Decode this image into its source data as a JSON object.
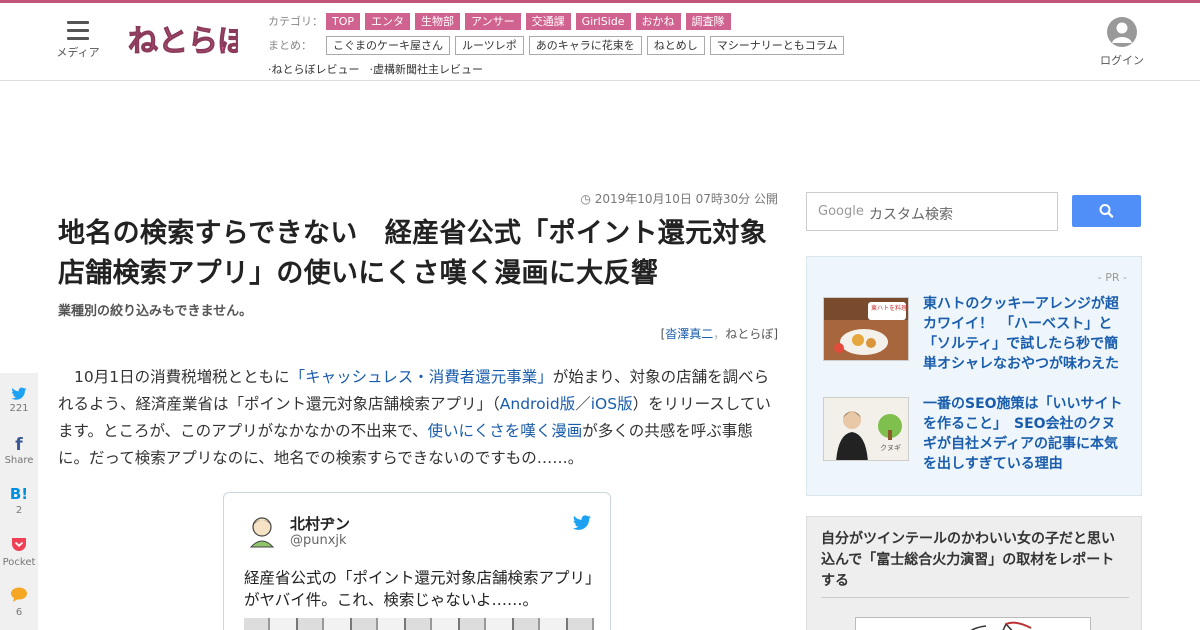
{
  "header": {
    "menu_label": "メディア",
    "logo_text": "ねとらぼ",
    "login_label": "ログイン",
    "category_label": "カテゴリ：",
    "categories": [
      "TOP",
      "エンタ",
      "生物部",
      "アンサー",
      "交通課",
      "GirlSide",
      "おかね",
      "調査隊"
    ],
    "matome_label": "まとめ：",
    "matome": [
      "こぐまのケーキ屋さん",
      "ルーツレポ",
      "あのキャラに花束を",
      "ねとめし",
      "マシーナリーともコラム"
    ],
    "links": [
      "·ねとらぼレビュー",
      "·虚構新聞社主レビュー"
    ]
  },
  "article": {
    "date": "2019年10月10日 07時30分 公開",
    "title": "地名の検索すらできない　経産省公式「ポイント還元対象店舗検索アプリ」の使いにくさ嘆く漫画に大反響",
    "subtitle": "業種別の絞り込みもできません。",
    "author_open": "[",
    "author_name": "沓澤真二",
    "author_sep": "，",
    "author_site": "ねとらぼ",
    "author_close": "]",
    "p1": "10月1日の消費税増税とともに",
    "link1": "「キャッシュレス・消費者還元事業」",
    "p2": "が始まり、対象の店舗を調べられるよう、経済産業省は「ポイント還元対象店舗検索アプリ」（",
    "link2": "Android版",
    "p3": "／",
    "link3": "iOS版",
    "p4": "）をリリースしています。ところが、このアプリがなかなかの不出来で、",
    "link4": "使いにくさを嘆く漫画",
    "p5": "が多くの共感を呼ぶ事態に。だって検索アプリなのに、地名での検索すらできないのですもの……。"
  },
  "tweet": {
    "name": "北村ヂン",
    "handle": "@punxjk",
    "text": "経産省公式の「ポイント還元対象店舗検索アプリ」がヤバイ件。これ、検索じゃないよ……。"
  },
  "share": {
    "twitter_count": "221",
    "facebook_label": "Share",
    "hatena_icon": "B!",
    "hatena_count": "2",
    "pocket_label": "Pocket",
    "comment_count": "6"
  },
  "sidebar": {
    "search_brand": "Google",
    "search_placeholder": "カスタム検索",
    "pr_label": "- PR -",
    "pr_items": [
      {
        "title": "東ハトのクッキーアレンジが超カワイイ！　「ハーベスト」と「ソルティ」で試したら秒で簡単オシャレなおやつが味わえた",
        "thumb_text": "東ハトを料理してみた"
      },
      {
        "title": "一番のSEO施策は「いいサイトを作ること」　SEO会社のクヌギが自社メディアの記事に本気を出しすぎている理由",
        "thumb_text": "クヌギ"
      }
    ],
    "rank_title": "自分がツインテールのかわいい女の子だと思い込んで「富士総合火力演習」の取材をレポートする"
  },
  "colors": {
    "brand": "#c2547a",
    "tag": "#d0628f",
    "link": "#1a5dad",
    "search_button": "#4f8ff7",
    "twitter": "#1da1f2"
  }
}
